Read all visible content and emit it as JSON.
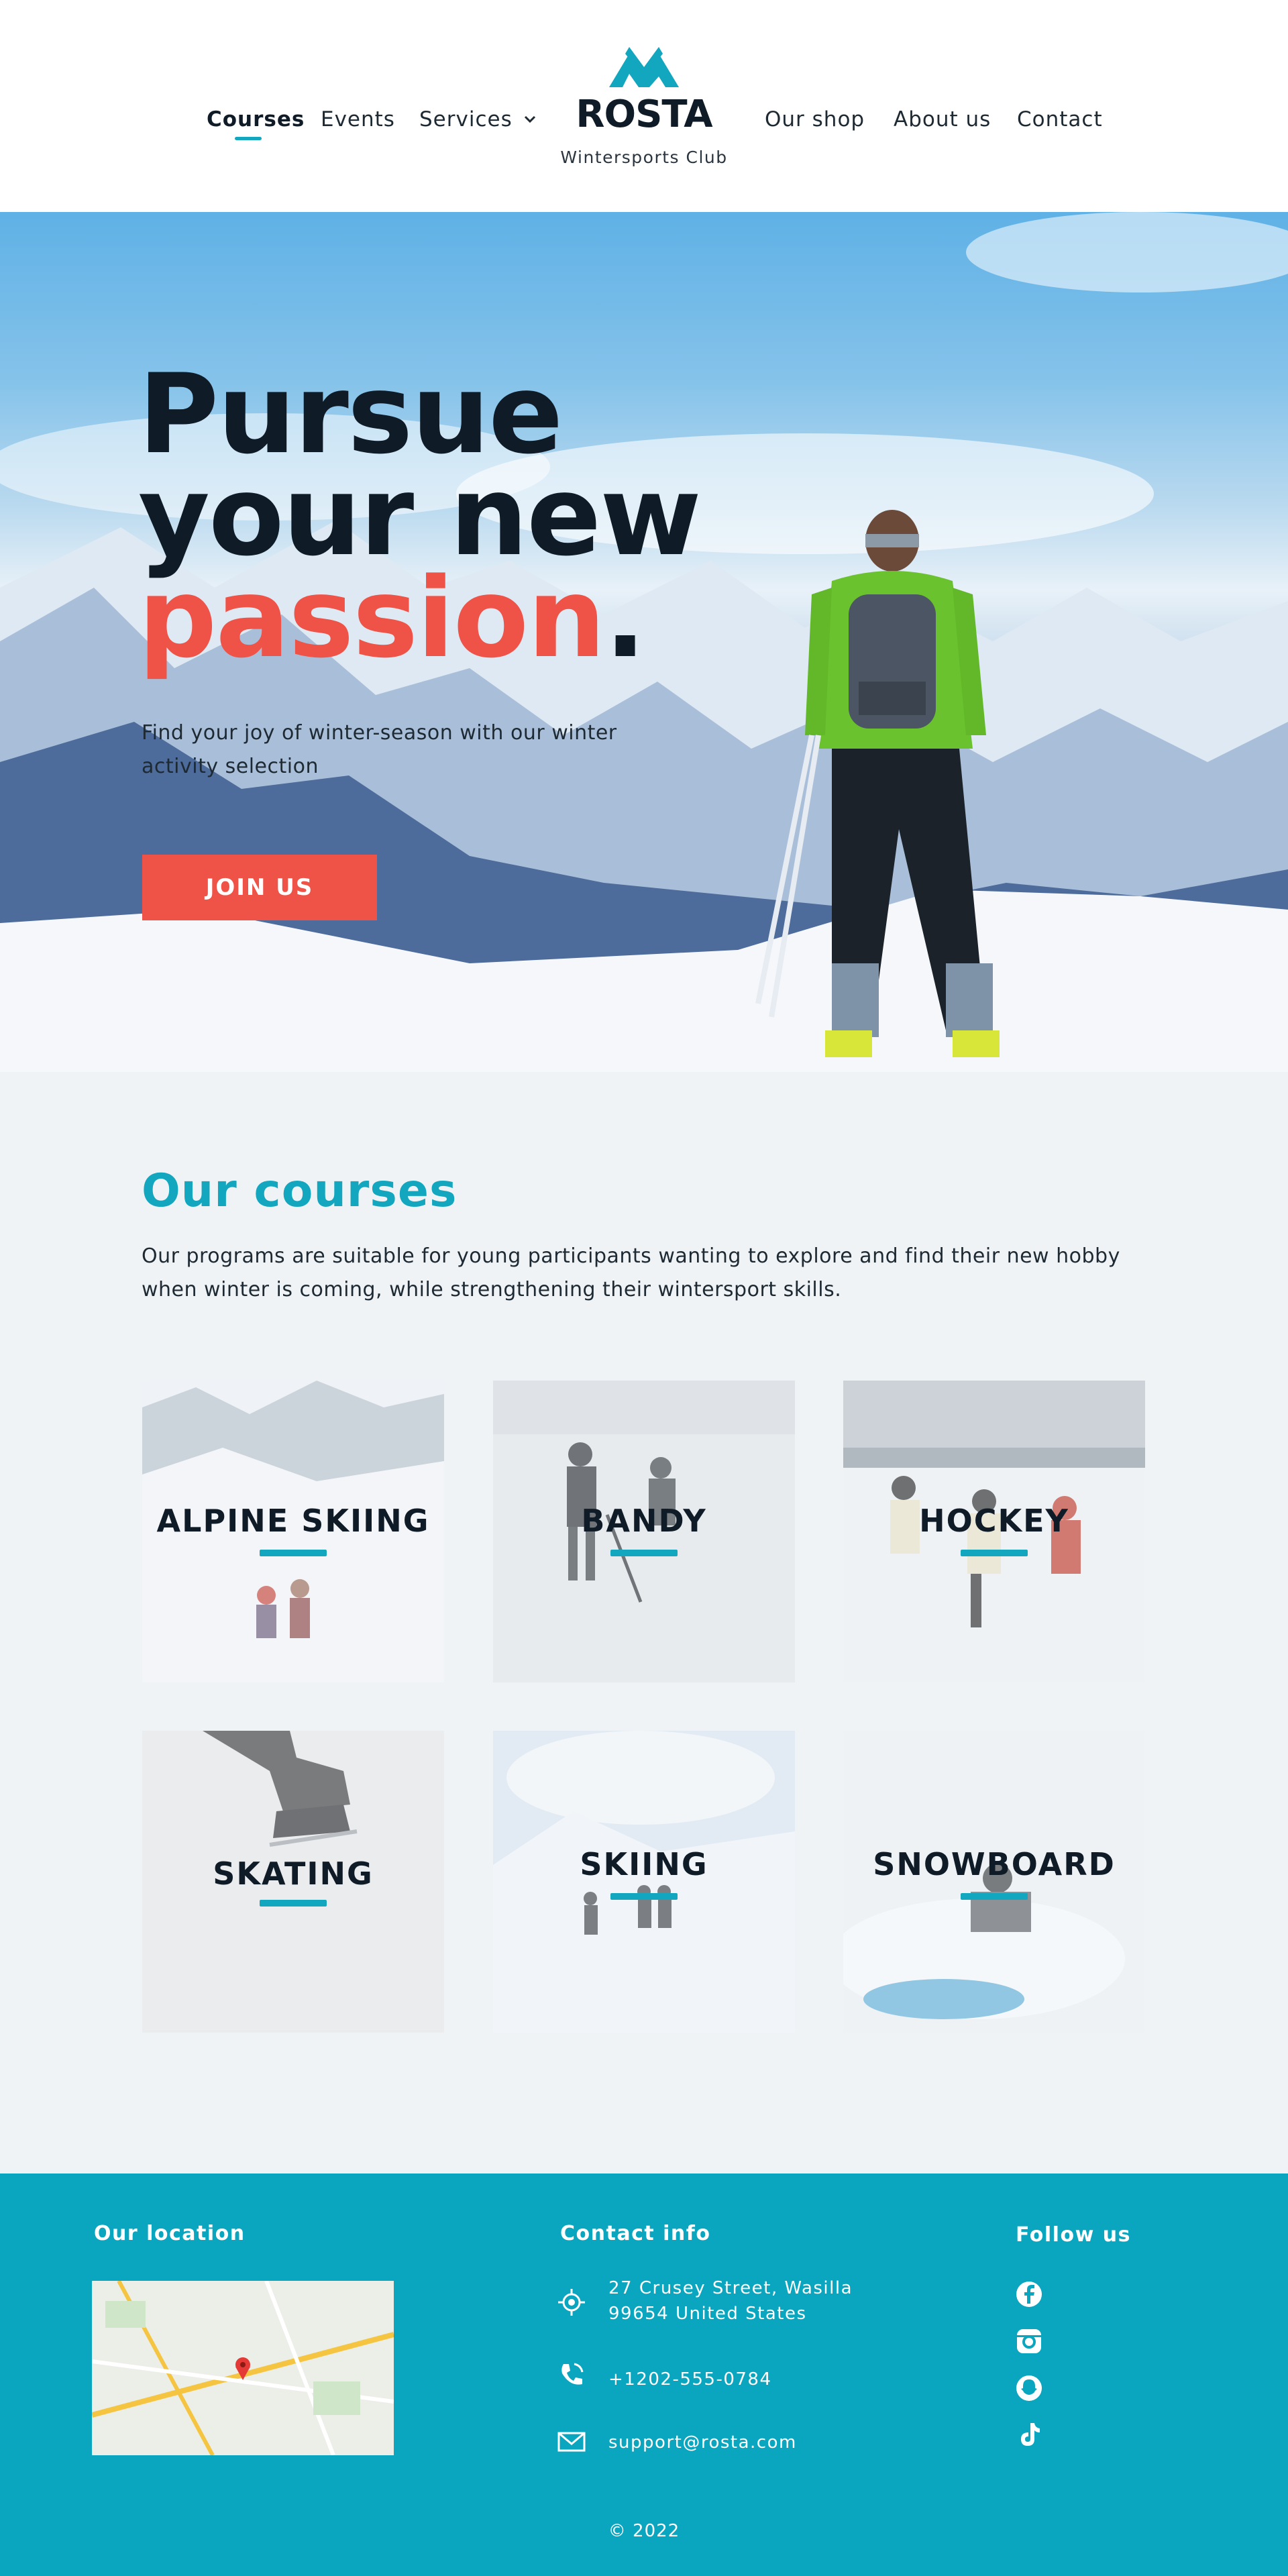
{
  "header": {
    "nav_left": [
      {
        "label": "Courses",
        "active": true
      },
      {
        "label": "Events",
        "active": false
      },
      {
        "label": "Services",
        "active": false
      }
    ],
    "nav_right": [
      {
        "label": "Our shop"
      },
      {
        "label": "About us"
      },
      {
        "label": "Contact"
      }
    ],
    "logo": {
      "name": "ROSTA",
      "tagline": "Wintersports Club"
    }
  },
  "hero": {
    "title_line1": "Pursue",
    "title_line2": "your new",
    "title_accent": "passion",
    "title_period": ".",
    "subtitle": "Find your joy of winter-season with our winter activity selection",
    "cta": "JOIN US"
  },
  "courses": {
    "title": "Our courses",
    "description": "Our programs are suitable for young participants wanting to explore and find their new hobby when winter is coming, while strengthening their wintersport skills.",
    "items": [
      {
        "label": "ALPINE SKIING"
      },
      {
        "label": "BANDY"
      },
      {
        "label": "HOCKEY"
      },
      {
        "label": "SKATING"
      },
      {
        "label": "SKIING"
      },
      {
        "label": "SNOWBOARD"
      }
    ]
  },
  "footer": {
    "location_title": "Our location",
    "contact_title": "Contact info",
    "follow_title": "Follow us",
    "address_line1": "27 Crusey Street, Wasilla",
    "address_line2": "99654 United States",
    "phone": "+1202-555-0784",
    "email": "support@rosta.com",
    "copyright": "© 2022",
    "social_icons": [
      "facebook-icon",
      "instagram-icon",
      "snapchat-icon",
      "tiktok-icon"
    ]
  },
  "colors": {
    "accent_teal": "#12a6bf",
    "accent_red": "#ef5246",
    "footer_bg": "#0aa5be",
    "dark_text": "#0f1b26"
  }
}
